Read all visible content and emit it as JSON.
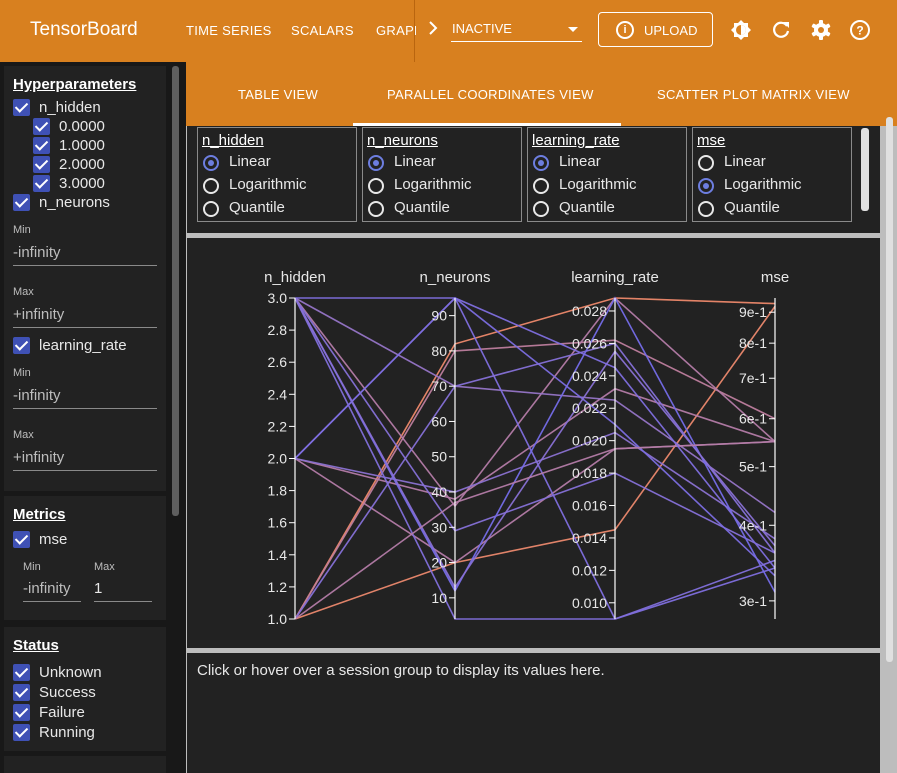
{
  "app": {
    "title": "TensorBoard"
  },
  "nav": {
    "tabs": [
      "TIME SERIES",
      "SCALARS",
      "GRAPHS"
    ],
    "selector_value": "INACTIVE",
    "upload_label": "UPLOAD"
  },
  "icons": {
    "theme": "brightness-icon",
    "refresh": "refresh-icon",
    "settings": "gear-icon",
    "help": "help-icon",
    "upload": "info-icon"
  },
  "colors": {
    "brand": "#d8801f",
    "accent": "#3f51b5"
  },
  "sidebar": {
    "hyperparameters": {
      "title": "Hyperparameters",
      "n_hidden": {
        "label": "n_hidden",
        "values": [
          "0.0000",
          "1.0000",
          "2.0000",
          "3.0000"
        ]
      },
      "n_neurons": {
        "label": "n_neurons",
        "min_label": "Min",
        "min": "-infinity",
        "max_label": "Max",
        "max": "+infinity"
      },
      "learning_rate": {
        "label": "learning_rate",
        "min_label": "Min",
        "min": "-infinity",
        "max_label": "Max",
        "max": "+infinity"
      }
    },
    "metrics": {
      "title": "Metrics",
      "mse": {
        "label": "mse",
        "min_label": "Min",
        "min": "-infinity",
        "max_label": "Max",
        "max": "1"
      }
    },
    "status": {
      "title": "Status",
      "items": [
        "Unknown",
        "Success",
        "Failure",
        "Running"
      ]
    }
  },
  "views": {
    "tabs": [
      "TABLE VIEW",
      "PARALLEL COORDINATES VIEW",
      "SCATTER PLOT MATRIX VIEW"
    ],
    "active": "PARALLEL COORDINATES VIEW"
  },
  "scales": [
    {
      "name": "n_hidden",
      "options": [
        "Linear",
        "Logarithmic",
        "Quantile"
      ],
      "selected": "Linear"
    },
    {
      "name": "n_neurons",
      "options": [
        "Linear",
        "Logarithmic",
        "Quantile"
      ],
      "selected": "Linear"
    },
    {
      "name": "learning_rate",
      "options": [
        "Linear",
        "Logarithmic",
        "Quantile"
      ],
      "selected": "Linear"
    },
    {
      "name": "mse",
      "options": [
        "Linear",
        "Logarithmic",
        "Quantile"
      ],
      "selected": "Logarithmic"
    }
  ],
  "chart_data": {
    "type": "parallel_coordinates",
    "axes": [
      {
        "name": "n_hidden",
        "scale": "linear",
        "domain": [
          1.0,
          3.0
        ],
        "ticks": [
          "1.0",
          "1.2",
          "1.4",
          "1.6",
          "1.8",
          "2.0",
          "2.2",
          "2.4",
          "2.6",
          "2.8",
          "3.0"
        ],
        "tick_values": [
          1.0,
          1.2,
          1.4,
          1.6,
          1.8,
          2.0,
          2.2,
          2.4,
          2.6,
          2.8,
          3.0
        ]
      },
      {
        "name": "n_neurons",
        "scale": "linear",
        "domain": [
          4,
          95
        ],
        "ticks": [
          "10",
          "20",
          "30",
          "40",
          "50",
          "60",
          "70",
          "80",
          "90"
        ],
        "tick_values": [
          10,
          20,
          30,
          40,
          50,
          60,
          70,
          80,
          90
        ]
      },
      {
        "name": "learning_rate",
        "scale": "linear",
        "domain": [
          0.009,
          0.0288
        ],
        "ticks": [
          "0.010",
          "0.012",
          "0.014",
          "0.016",
          "0.018",
          "0.020",
          "0.022",
          "0.024",
          "0.026",
          "0.028"
        ],
        "tick_values": [
          0.01,
          0.012,
          0.014,
          0.016,
          0.018,
          0.02,
          0.022,
          0.024,
          0.026,
          0.028
        ]
      },
      {
        "name": "mse",
        "scale": "log",
        "domain": [
          0.28,
          0.95
        ],
        "ticks": [
          "3e-1",
          "4e-1",
          "5e-1",
          "6e-1",
          "7e-1",
          "8e-1",
          "9e-1"
        ],
        "tick_values": [
          0.3,
          0.4,
          0.5,
          0.6,
          0.7,
          0.8,
          0.9
        ]
      }
    ],
    "color_low": "#6a6af5",
    "color_high": "#f08a6a",
    "sessions": [
      [
        1,
        20,
        0.0145,
        0.92
      ],
      [
        2,
        20,
        0.0195,
        0.55
      ],
      [
        1,
        82,
        0.0288,
        0.93
      ],
      [
        1,
        80,
        0.0262,
        0.6
      ],
      [
        3,
        36,
        0.0288,
        0.55
      ],
      [
        2,
        38,
        0.0232,
        0.55
      ],
      [
        3,
        70,
        0.0225,
        0.42
      ],
      [
        3,
        95,
        0.009,
        0.34
      ],
      [
        2,
        40,
        0.0205,
        0.38
      ],
      [
        3,
        29,
        0.018,
        0.36
      ],
      [
        1,
        70,
        0.026,
        0.36
      ],
      [
        3,
        12,
        0.0288,
        0.31
      ],
      [
        2,
        95,
        0.021,
        0.33
      ],
      [
        3,
        4,
        0.009,
        0.35
      ],
      [
        3,
        13,
        0.0255,
        0.37
      ],
      [
        1,
        37,
        0.0195,
        0.55
      ],
      [
        2,
        95,
        0.0245,
        0.34
      ]
    ]
  },
  "info": {
    "message": "Click or hover over a session group to display its values here."
  }
}
